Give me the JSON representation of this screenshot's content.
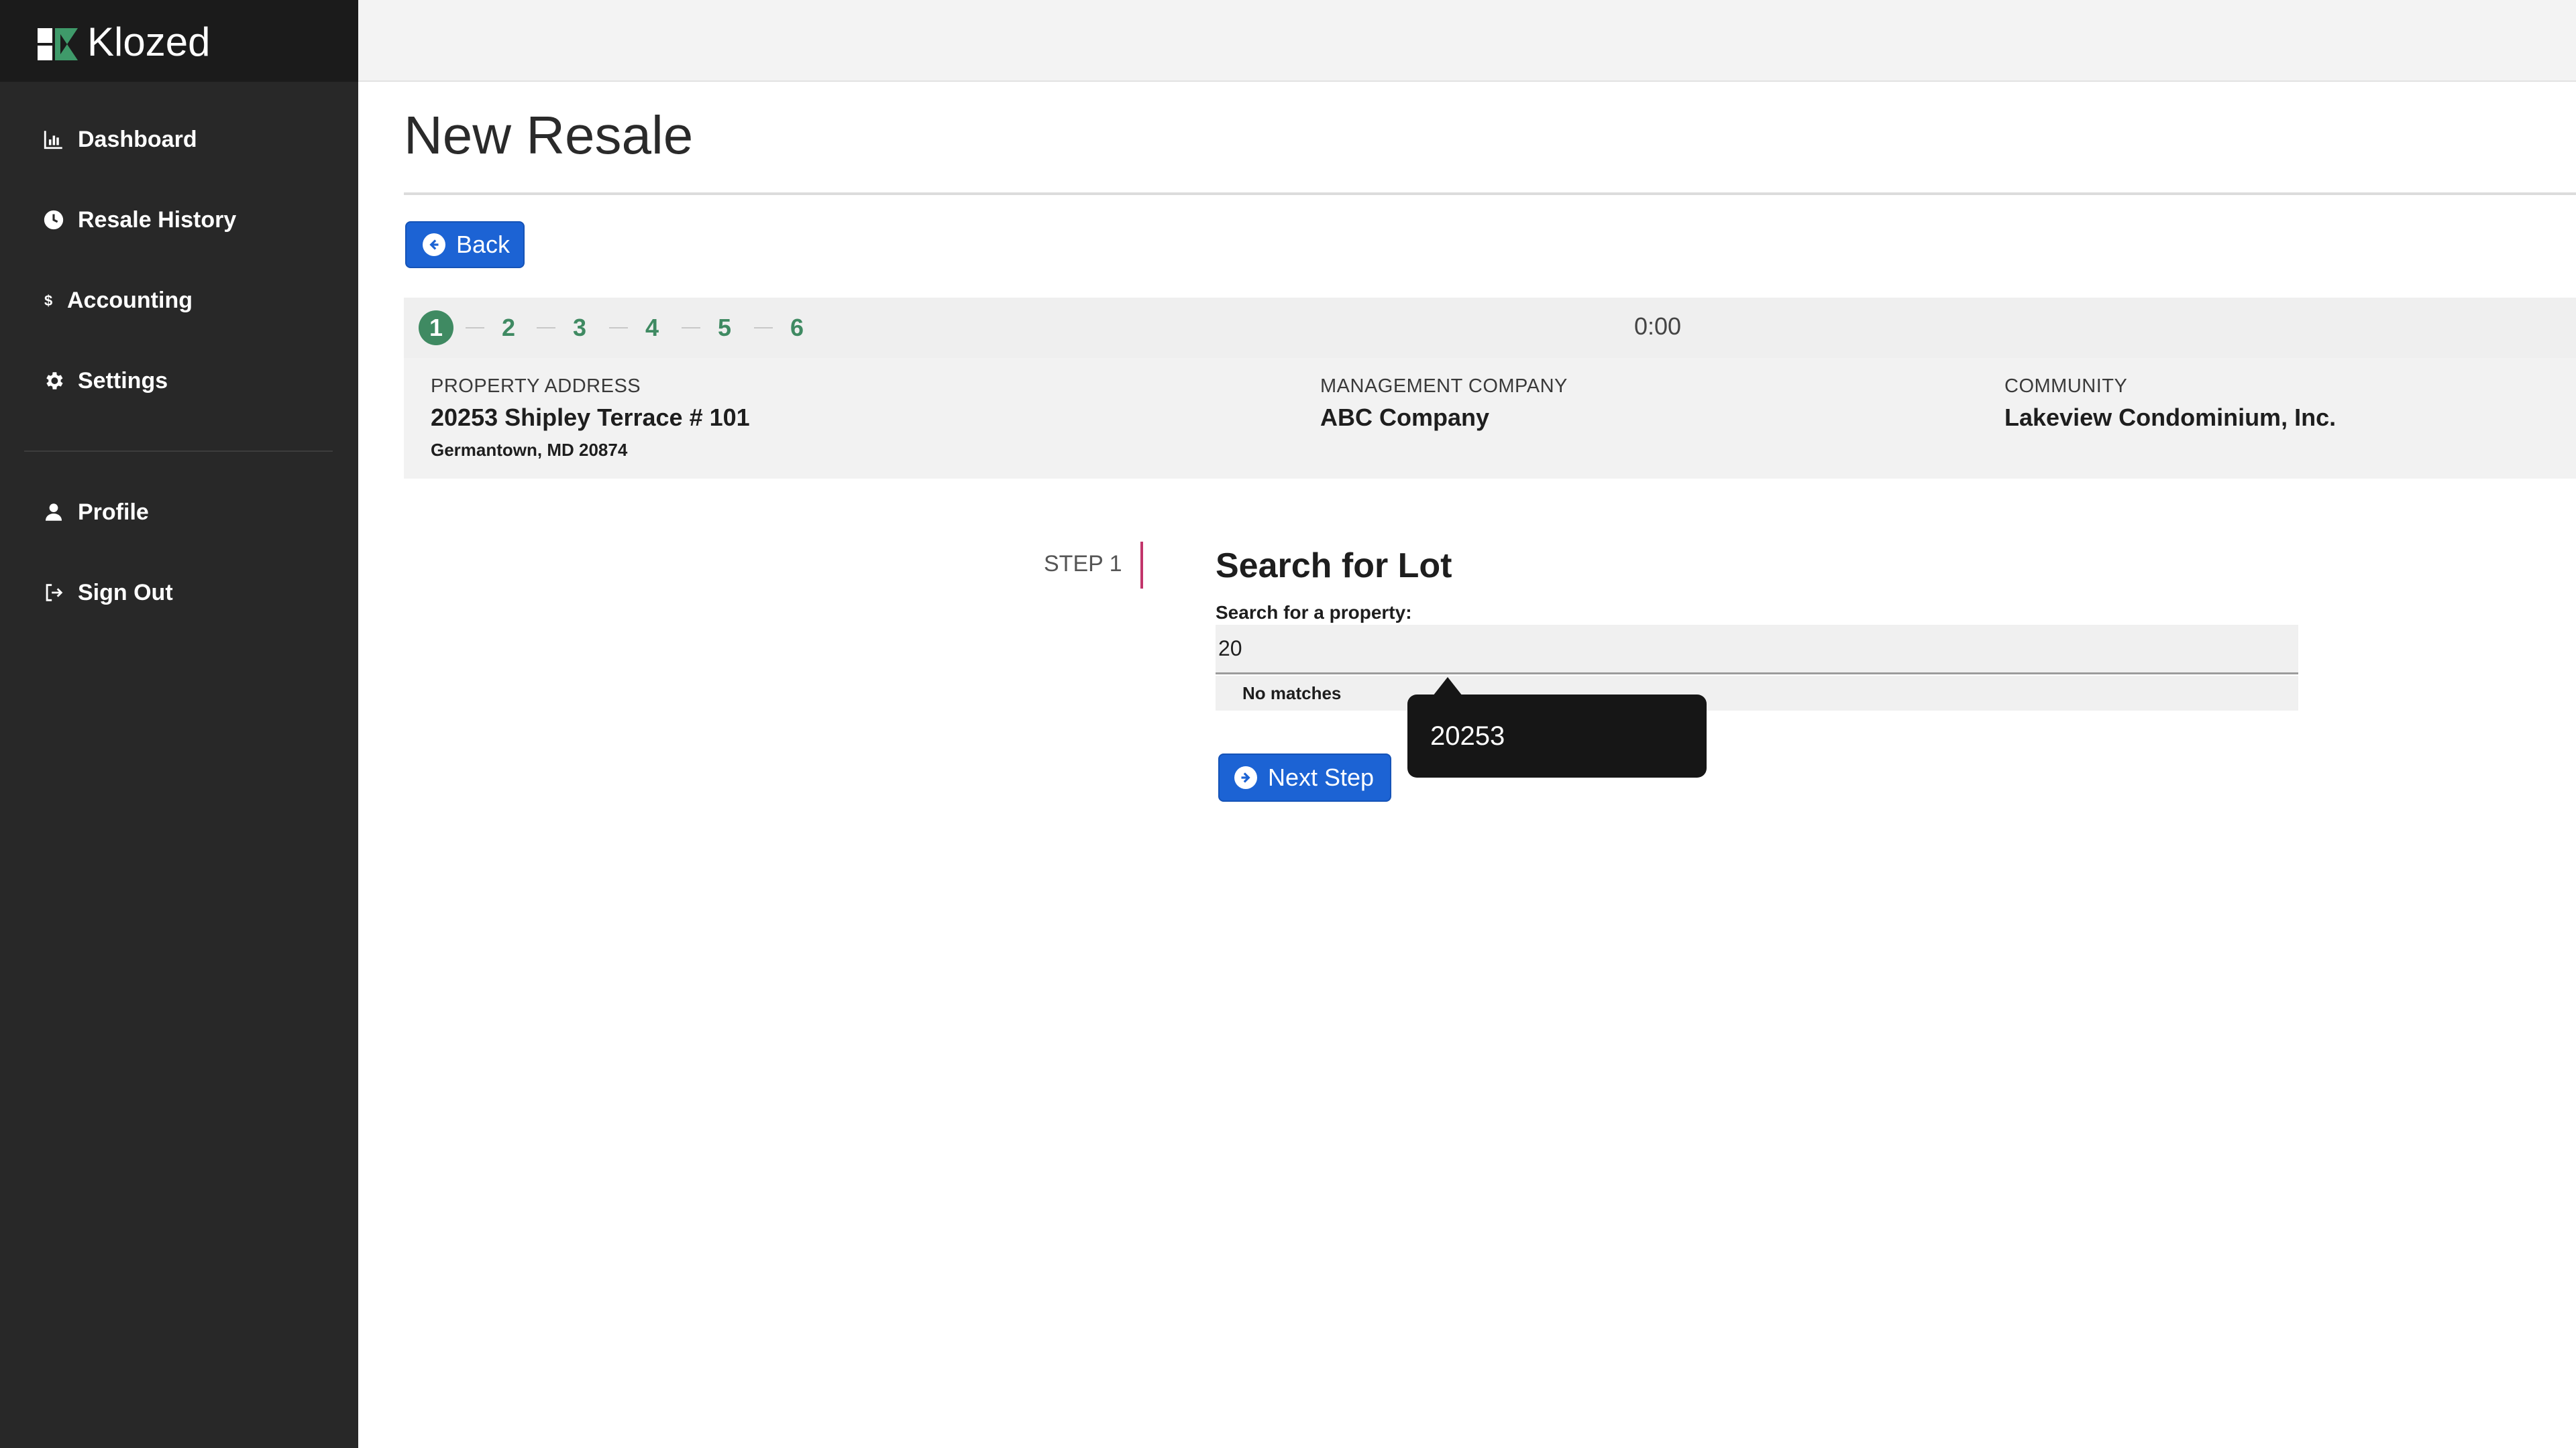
{
  "brand": {
    "name": "Klozed"
  },
  "sidebar": {
    "items": [
      {
        "label": "Dashboard",
        "icon": "chart-bar-icon"
      },
      {
        "label": "Resale History",
        "icon": "clock-icon"
      },
      {
        "label": "Accounting",
        "icon": "dollar-icon"
      },
      {
        "label": "Settings",
        "icon": "gear-icon"
      },
      {
        "label": "Profile",
        "icon": "user-icon"
      },
      {
        "label": "Sign Out",
        "icon": "sign-out-icon"
      }
    ]
  },
  "page": {
    "title": "New Resale",
    "back_label": "Back",
    "next_label": "Next Step"
  },
  "stepper": {
    "steps": [
      "1",
      "2",
      "3",
      "4",
      "5",
      "6"
    ],
    "active": "1",
    "timer": "0:00"
  },
  "property": {
    "address_label": "PROPERTY ADDRESS",
    "address": "20253 Shipley Terrace # 101",
    "city_line": "Germantown, MD 20874",
    "management_label": "MANAGEMENT COMPANY",
    "management": "ABC Company",
    "community_label": "COMMUNITY",
    "community": "Lakeview Condominium, Inc."
  },
  "search": {
    "step_label": "STEP 1",
    "title": "Search for Lot",
    "field_label": "Search for a property:",
    "value": "20",
    "no_matches": "No matches",
    "tooltip": "20253"
  },
  "colors": {
    "sidebar": "#282828",
    "primary": "#1c63d4",
    "step_green": "#3f8a62",
    "step_accent": "#c2356b"
  }
}
